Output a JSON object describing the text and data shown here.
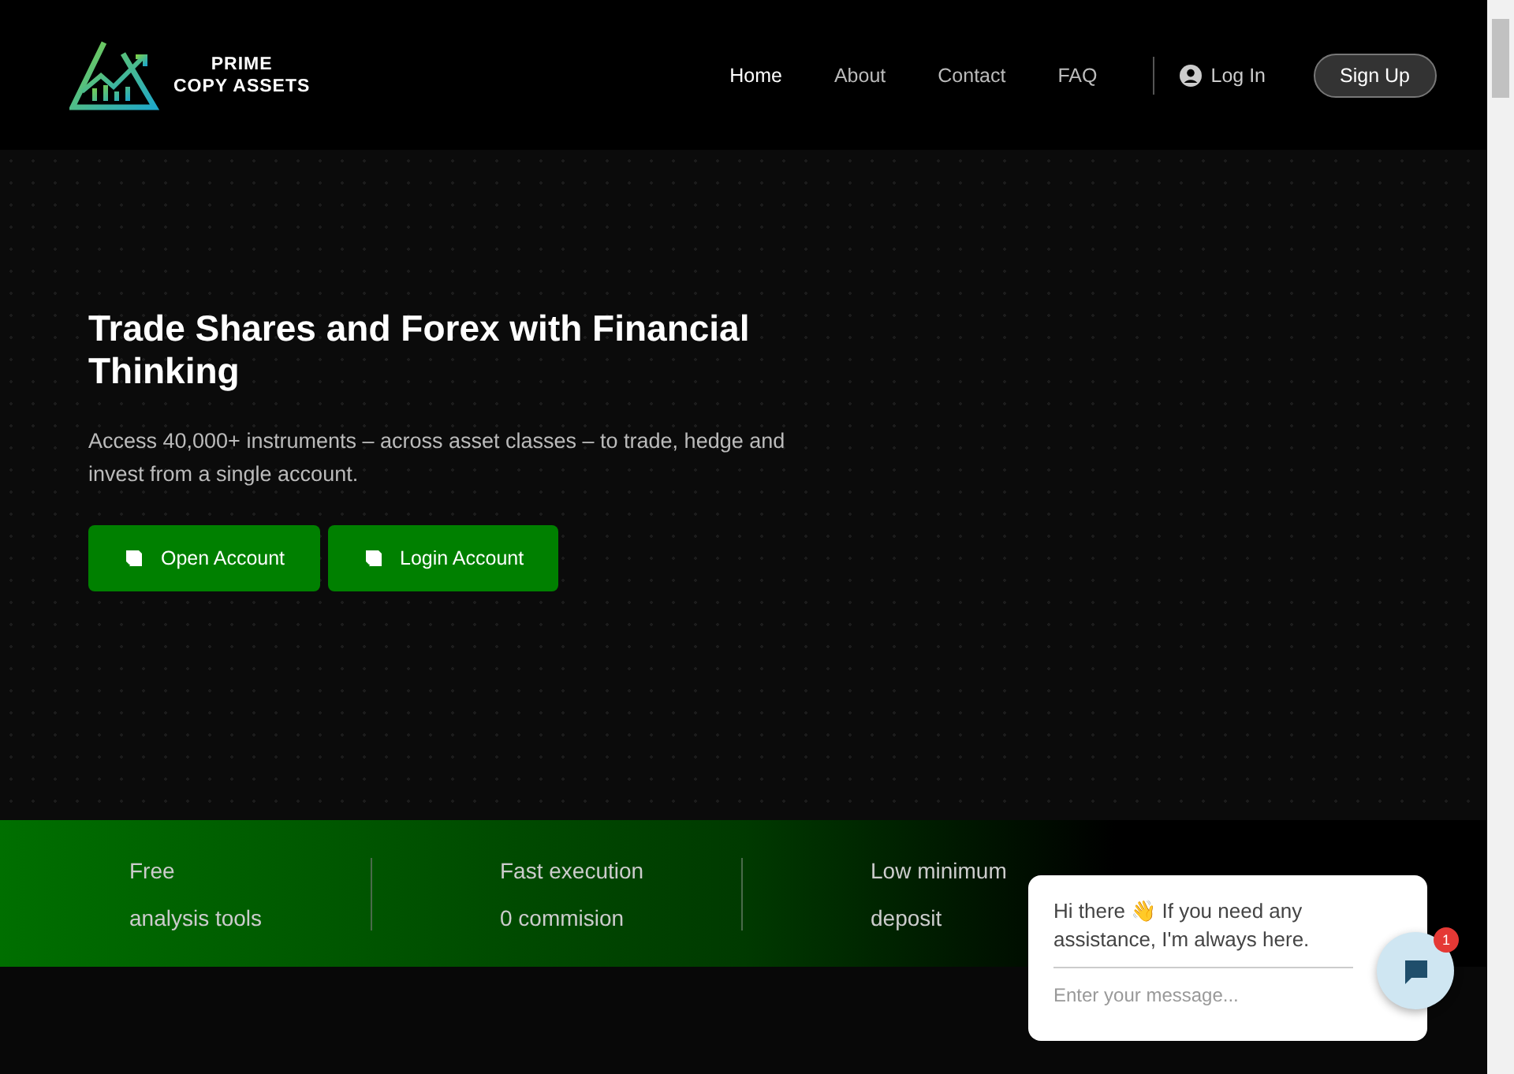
{
  "brand": {
    "line_1": "PRIME",
    "line_2": "COPY ASSETS"
  },
  "nav": [
    {
      "label": "Home",
      "selected": true
    },
    {
      "label": "About",
      "selected": false
    },
    {
      "label": "Contact",
      "selected": false
    },
    {
      "label": "FAQ",
      "selected": false
    }
  ],
  "login": "Log In",
  "signup": "Sign Up",
  "hero": {
    "title": "Trade Shares and Forex with Financial Thinking",
    "text": "Access 40,000+ instruments – across asset classes – to trade, hedge and invest from a single account.",
    "buttons": [
      "Open Account",
      "Login Account"
    ]
  },
  "features": [
    {
      "line_1": "Free",
      "line_2": "analysis tools"
    },
    {
      "line_1": "Fast execution",
      "line_2": "0 commision"
    },
    {
      "line_1": "Low minimum",
      "line_2": "deposit"
    }
  ],
  "chat": {
    "greeting": "Hi there 👋 If you need any assistance, I'm always here.",
    "placeholder": "Enter your message...",
    "badge": "1"
  }
}
